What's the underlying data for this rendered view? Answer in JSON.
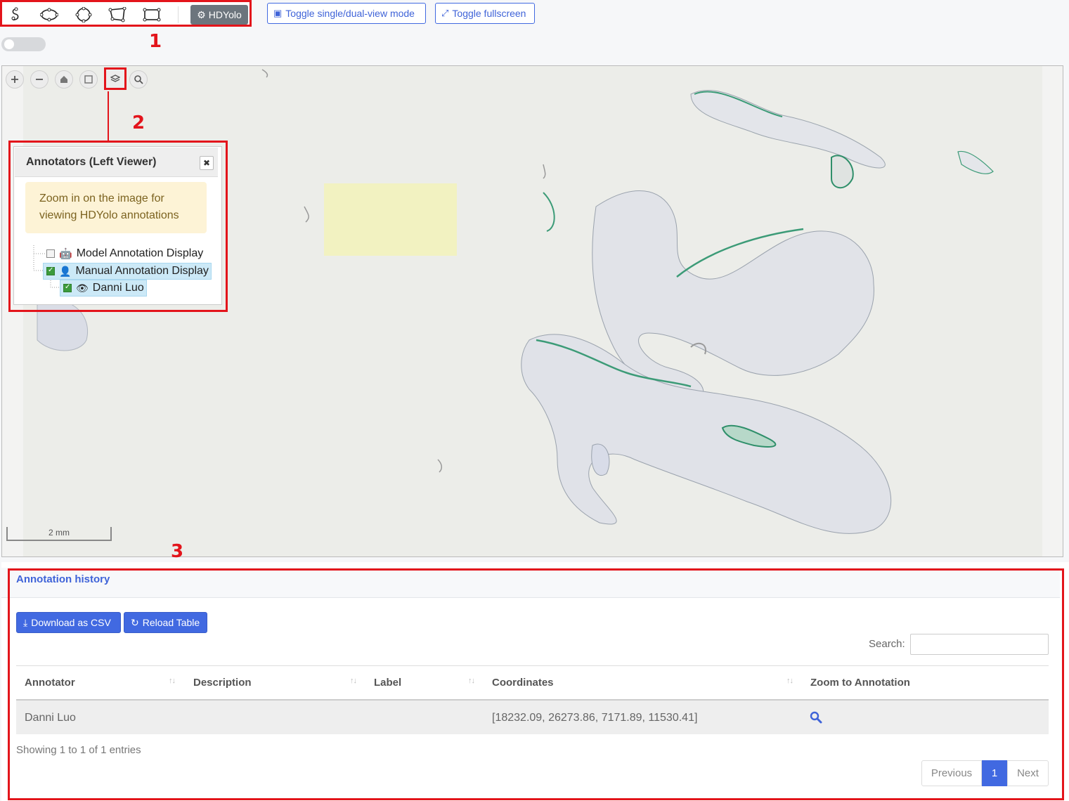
{
  "toolbar": {
    "tools": [
      "freehand-draw-icon",
      "ellipse-draw-icon",
      "circle-draw-icon",
      "polygon-draw-icon",
      "rectangle-draw-icon"
    ],
    "hdyolo_label": "HDYolo",
    "toggle_view_label": "Toggle single/dual-view mode",
    "toggle_fullscreen_label": "Toggle fullscreen"
  },
  "callouts": {
    "one": "1",
    "two": "2",
    "three": "3"
  },
  "viewer": {
    "controls": [
      "zoom-in-icon",
      "zoom-out-icon",
      "home-icon",
      "fullpage-icon",
      "layers-icon",
      "magnify-icon"
    ],
    "scale_label": "2 mm"
  },
  "annotators": {
    "title": "Annotators (Left Viewer)",
    "zoom_note": "Zoom in on the image for viewing HDYolo annotations",
    "items": [
      {
        "label": "Model Annotation Display",
        "checked": false,
        "icon": "robot-icon"
      },
      {
        "label": "Manual Annotation Display",
        "checked": true,
        "icon": "user-icon"
      },
      {
        "label": "Danni Luo",
        "checked": true,
        "icon": "eye-icon"
      }
    ]
  },
  "history": {
    "title": "Annotation history",
    "download_label": "Download as CSV",
    "reload_label": "Reload Table",
    "search_label": "Search:",
    "columns": [
      "Annotator",
      "Description",
      "Label",
      "Coordinates",
      "Zoom to Annotation"
    ],
    "rows": [
      {
        "annotator": "Danni Luo",
        "description": "",
        "label": "",
        "coordinates": "[18232.09, 26273.86, 7171.89, 11530.41]"
      }
    ],
    "info": "Showing 1 to 1 of 1 entries",
    "pagination": {
      "previous": "Previous",
      "current": "1",
      "next": "Next"
    }
  },
  "colors": {
    "accent": "#4169e1",
    "callout": "#e3141b",
    "tissue_stain": "#2f8f6a",
    "highlight_box": "#f3f2bd"
  }
}
